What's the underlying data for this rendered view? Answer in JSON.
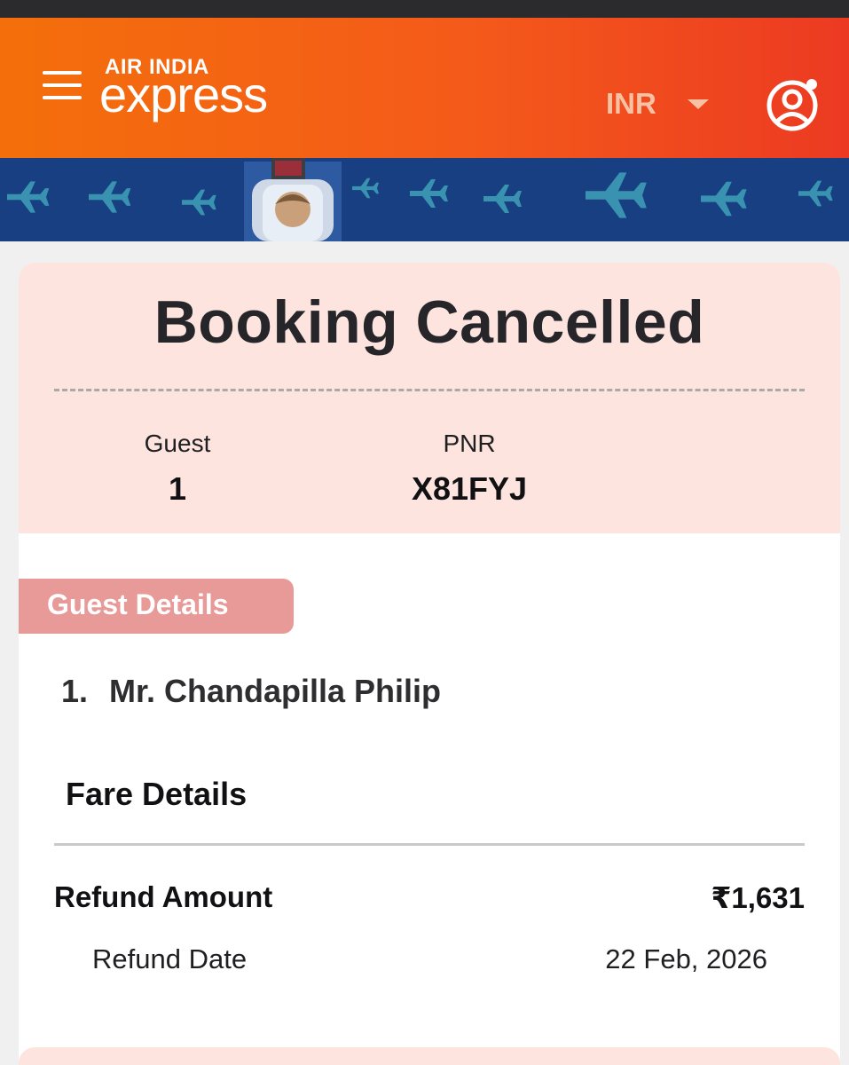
{
  "brand": {
    "line1": "AIR INDIA",
    "line2": "express",
    "header_color": "#f46f0b",
    "accent_color": "#ec3a22"
  },
  "header": {
    "menu_icon": "hamburger-menu-icon",
    "currency": "INR",
    "profile_icon": "user-profile-icon"
  },
  "booking": {
    "title": "Booking Cancelled",
    "guest_label": "Guest",
    "guest_count": "1",
    "pnr_label": "PNR",
    "pnr_value": "X81FYJ"
  },
  "guest_details": {
    "heading": "Guest Details",
    "guests": [
      {
        "number": "1.",
        "name": "Mr. Chandapilla Philip"
      }
    ]
  },
  "fare_details": {
    "heading": "Fare Details",
    "refund_amount_label": "Refund Amount",
    "refund_amount_value": "₹1,631",
    "refund_date_label": "Refund Date",
    "refund_date_value": "22 Feb, 2026"
  }
}
